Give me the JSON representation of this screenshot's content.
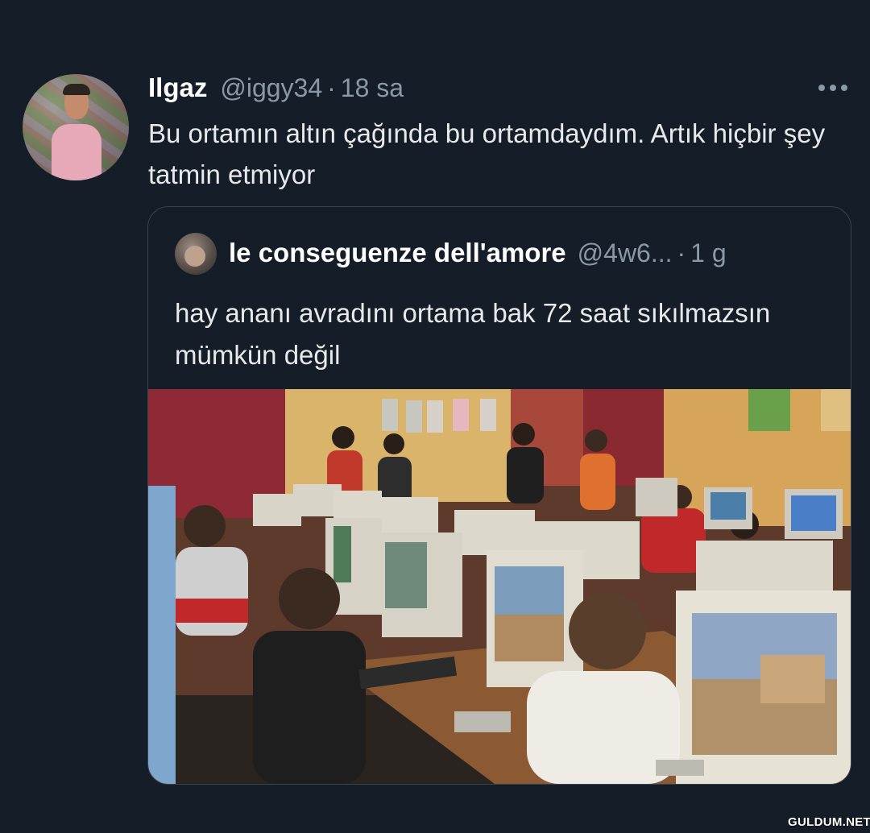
{
  "tweet": {
    "author_name": "Ilgaz",
    "author_handle": "@iggy34",
    "separator": "·",
    "time": "18 sa",
    "text": "Bu ortamın altın çağında bu ortamdaydım. Artık hiçbir şey tatmin etmiyor",
    "more_icon": "more-horizontal-icon"
  },
  "quoted_tweet": {
    "author_name": "le conseguenze dell'amore",
    "author_handle": "@4w6...",
    "separator": "·",
    "time": "1 g",
    "text": "hay ananı avradını ortama bak 72 saat sıkılmazsın mümkün değil"
  },
  "watermark": "GULDUM.NET",
  "colors": {
    "background": "#151d28",
    "text_primary": "#e7e9ea",
    "text_secondary": "#8b98a5",
    "border": "#38444d"
  }
}
